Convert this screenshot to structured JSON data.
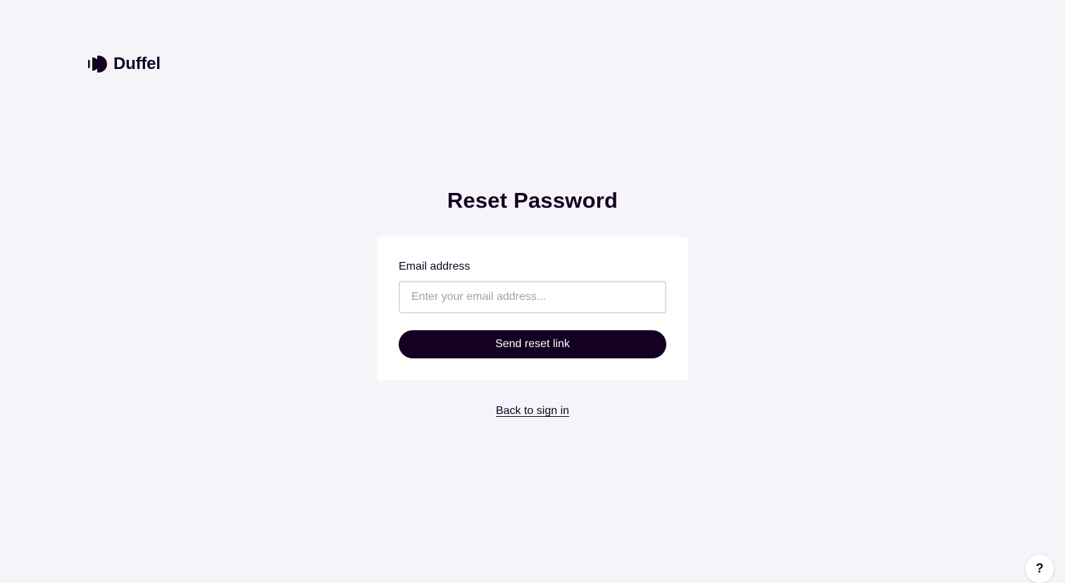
{
  "brand": {
    "name": "Duffel",
    "logo_icon": "duffel-logo-icon",
    "color": "#140022"
  },
  "page": {
    "title": "Reset Password",
    "background": "#f5f5f9"
  },
  "form": {
    "email_label": "Email address",
    "email_placeholder": "Enter your email address...",
    "email_value": "",
    "submit_label": "Send reset link"
  },
  "footer": {
    "back_link_label": "Back to sign in"
  },
  "help": {
    "icon": "question-mark-icon",
    "label": "?"
  }
}
